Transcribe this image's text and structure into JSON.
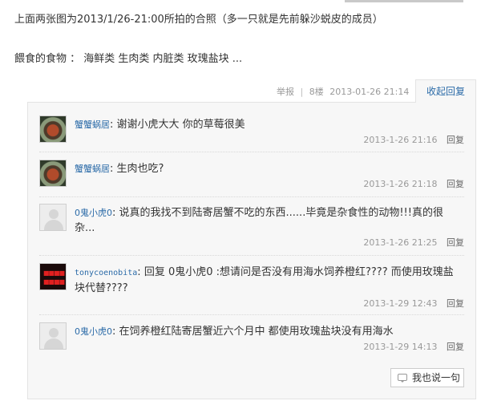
{
  "post": {
    "line1": "上面两张图为2013/1/26-21:00所拍的合照（多一只就是先前躲沙蜕皮的成员）",
    "line2": "餵食的食物 ： 海鲜类 生肉类 内脏类 玫瑰盐块 ..."
  },
  "floor_meta": {
    "report": "举报",
    "separator": "|",
    "floor": "8楼",
    "date": "2013-01-26 21:14",
    "collapse_label": "收起回复"
  },
  "comments": [
    {
      "user": "蟹蟹蜗居",
      "colon": ":",
      "text": "谢谢小虎大大 你的草莓很美",
      "time": "2013-1-26 21:16",
      "reply": "回复",
      "avatar": "crab-photo"
    },
    {
      "user": "蟹蟹蜗居",
      "colon": ":",
      "text": "生肉也吃?",
      "time": "2013-1-26 21:18",
      "reply": "回复",
      "avatar": "crab-photo"
    },
    {
      "user": "0鬼小虎0",
      "colon": ":",
      "text": "说真的我找不到陆寄居蟹不吃的东西......毕竟是杂食性的动物!!!真的很杂...",
      "time": "2013-1-26 21:25",
      "reply": "回复",
      "avatar": "default-user"
    },
    {
      "user": "tonycoenobita",
      "colon": ":",
      "text": "回复 0鬼小虎0 :想请问是否没有用海水饲养橙红???? 而使用玫瑰盐块代替????",
      "time": "2013-1-29 12:43",
      "reply": "回复",
      "avatar": "red-logo"
    },
    {
      "user": "0鬼小虎0",
      "colon": ":",
      "text": "在饲养橙红陆寄居蟹近六个月中 都使用玫瑰盐块没有用海水",
      "time": "2013-1-29 14:13",
      "reply": "回复",
      "avatar": "default-user"
    }
  ],
  "say_button": {
    "label": "我也说一句",
    "icon": "speech-bubble-icon"
  },
  "colors": {
    "link": "#2b6ba8",
    "meta": "#999999",
    "panel_bg": "#f7f7f7",
    "panel_border": "#e3e3e3"
  }
}
